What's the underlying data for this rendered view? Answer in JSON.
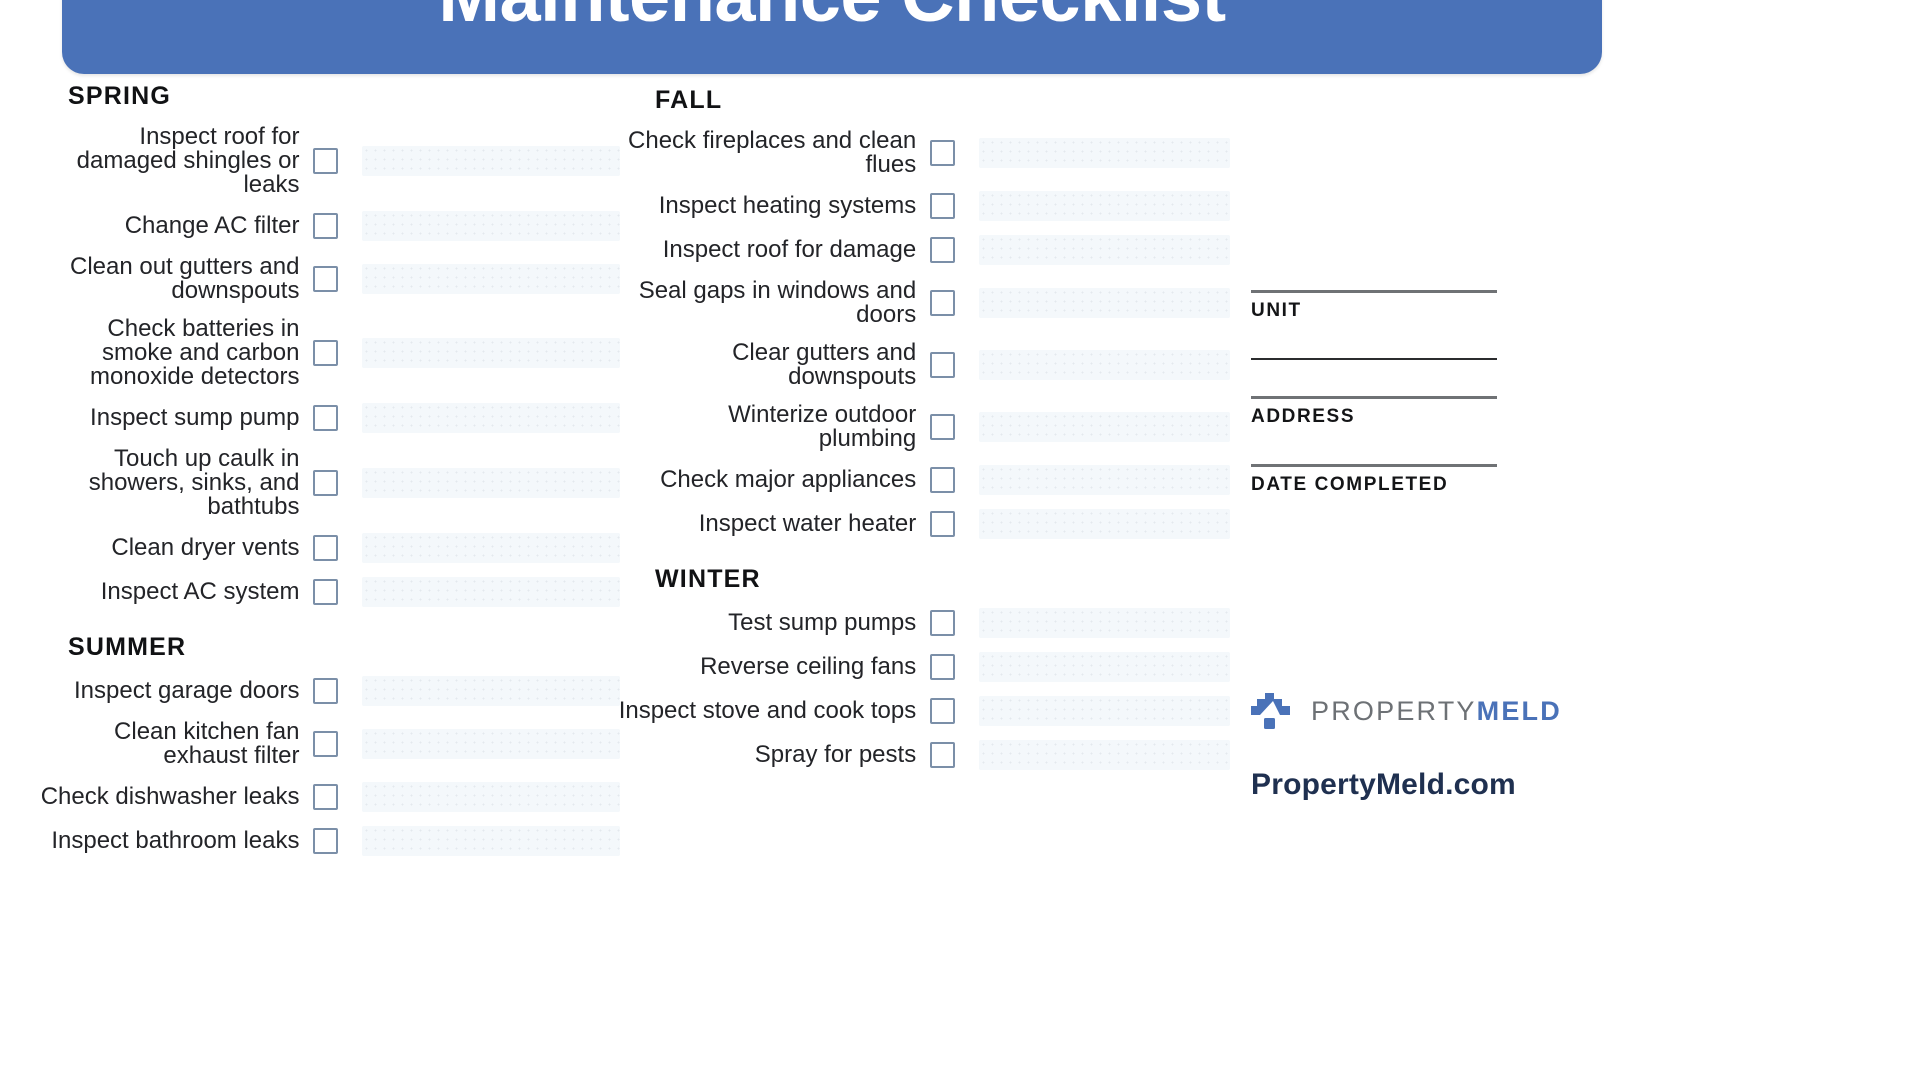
{
  "header": {
    "title": "Maintenance Checklist",
    "banner_color": "#4a72b8",
    "title_color": "#ffffff"
  },
  "seasons": [
    {
      "name": "SPRING",
      "column": "left",
      "items": [
        "Inspect roof for\ndamaged shingles or\nleaks",
        "Change AC filter",
        "Clean out gutters and\ndownspouts",
        "Check batteries in\nsmoke and carbon\nmonoxide detectors",
        "Inspect sump pump",
        "Touch up caulk in\nshowers, sinks, and\nbathtubs",
        "Clean dryer vents",
        "Inspect AC system"
      ]
    },
    {
      "name": "SUMMER",
      "column": "left",
      "items": [
        "Inspect garage doors",
        "Clean kitchen fan\nexhaust filter",
        "Check dishwasher leaks",
        "Inspect bathroom leaks"
      ]
    },
    {
      "name": "FALL",
      "column": "middle",
      "items": [
        "Check fireplaces and clean\nflues",
        "Inspect heating systems",
        "Inspect roof for damage",
        "Seal gaps in windows and\ndoors",
        "Clear gutters and\ndownspouts",
        "Winterize outdoor\nplumbing",
        "Check major appliances",
        "Inspect water heater"
      ]
    },
    {
      "name": "WINTER",
      "column": "middle",
      "items": [
        "Test sump pumps",
        "Reverse ceiling fans",
        "Inspect stove and cook tops",
        "Spray for pests"
      ]
    }
  ],
  "form_fields": [
    {
      "label": "UNIT",
      "value": ""
    },
    {
      "label": "",
      "value": ""
    },
    {
      "label": "ADDRESS",
      "value": ""
    },
    {
      "label": "DATE COMPLETED",
      "value": ""
    }
  ],
  "branding": {
    "logo_icon": "house-roof-icon",
    "logo_text_primary": "PROPERTY",
    "logo_text_secondary": "MELD",
    "website": "PropertyMeld.com",
    "primary_color": "#4a72b8",
    "gray_color": "#6d7175",
    "url_color": "#1f3050"
  },
  "checkbox": {
    "state": "unchecked",
    "border_color": "#7b8fa8"
  },
  "fill_line_color": "#f4f8fb"
}
